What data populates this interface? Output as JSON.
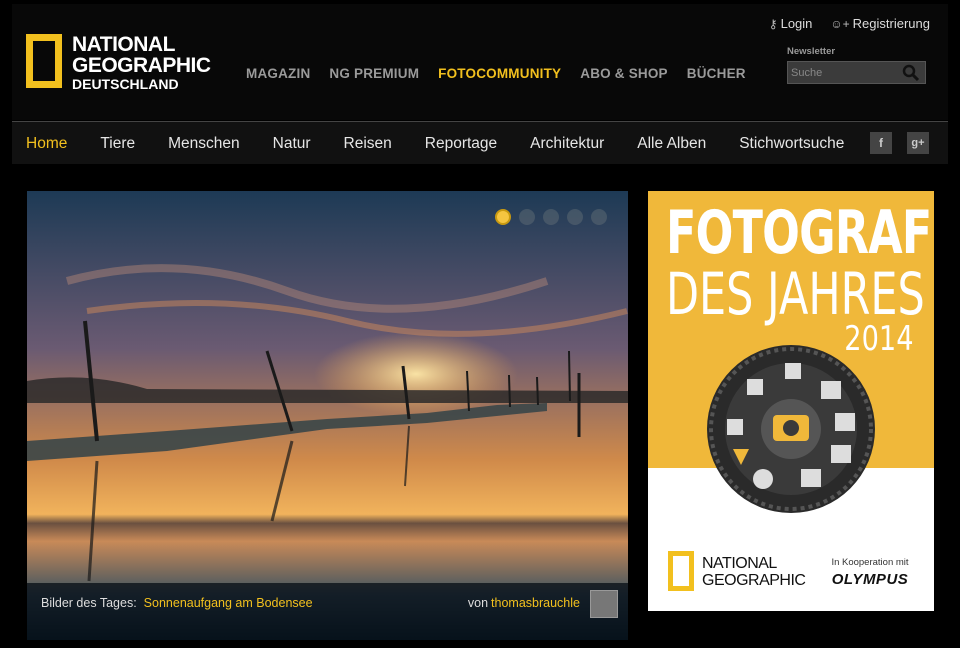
{
  "logo": {
    "line1": "NATIONAL",
    "line2": "GEOGRAPHIC",
    "line3": "DEUTSCHLAND"
  },
  "account": {
    "login": "Login",
    "register": "Registrierung"
  },
  "newsletter": {
    "label": "Newsletter",
    "search_placeholder": "Suche"
  },
  "topnav": [
    "MAGAZIN",
    "NG PREMIUM",
    "FOTOCOMMUNITY",
    "ABO & SHOP",
    "BÜCHER"
  ],
  "subnav": [
    "Home",
    "Tiere",
    "Menschen",
    "Natur",
    "Reisen",
    "Reportage",
    "Architektur",
    "Alle Alben",
    "Stichwortsuche"
  ],
  "social": {
    "facebook": "f",
    "googleplus": "g+"
  },
  "hero": {
    "caption_prefix": "Bilder des Tages:",
    "caption_title": "Sonnenaufgang am Bodensee",
    "by": "von",
    "user": "thomasbrauchle",
    "slide_count": 5,
    "active_slide": 1
  },
  "ad": {
    "title1": "FOTOGRAF",
    "title2": "DES JAHRES",
    "year": "2014",
    "logo_line1": "NATIONAL",
    "logo_line2": "GEOGRAPHIC",
    "coop": "In Kooperation mit",
    "brand": "OLYMPUS"
  },
  "colors": {
    "accent": "#f2c01e",
    "ad_bg": "#f0b83a",
    "header_bg": "#080808"
  }
}
